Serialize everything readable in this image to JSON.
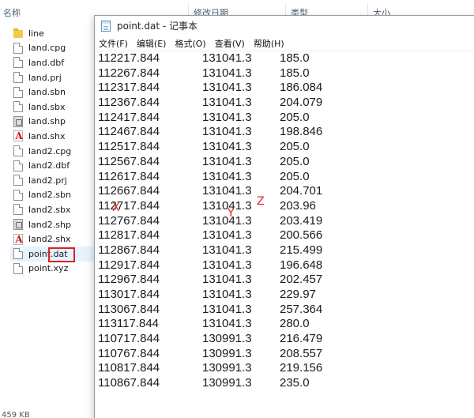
{
  "explorer": {
    "columns": [
      "名称",
      "修改日期",
      "类型",
      "大小"
    ],
    "files": [
      {
        "name": "line",
        "icon": "folder-icon"
      },
      {
        "name": "land.cpg",
        "icon": "file-icon"
      },
      {
        "name": "land.dbf",
        "icon": "file-icon"
      },
      {
        "name": "land.prj",
        "icon": "file-icon"
      },
      {
        "name": "land.sbn",
        "icon": "file-icon"
      },
      {
        "name": "land.sbx",
        "icon": "file-icon"
      },
      {
        "name": "land.shp",
        "icon": "shp-file-icon"
      },
      {
        "name": "land.shx",
        "icon": "shx-file-icon"
      },
      {
        "name": "land2.cpg",
        "icon": "file-icon"
      },
      {
        "name": "land2.dbf",
        "icon": "file-icon"
      },
      {
        "name": "land2.prj",
        "icon": "file-icon"
      },
      {
        "name": "land2.sbn",
        "icon": "file-icon"
      },
      {
        "name": "land2.sbx",
        "icon": "file-icon"
      },
      {
        "name": "land2.shp",
        "icon": "shp-file-icon"
      },
      {
        "name": "land2.shx",
        "icon": "shx-file-icon"
      },
      {
        "name": "point.dat",
        "icon": "file-icon",
        "selected": true
      },
      {
        "name": "point.xyz",
        "icon": "file-icon"
      }
    ],
    "status": "459 KB"
  },
  "notepad": {
    "title": "point.dat - 记事本",
    "menu": [
      "文件(F)",
      "编辑(E)",
      "格式(O)",
      "查看(V)",
      "帮助(H)"
    ],
    "rows": [
      [
        "112217.844",
        "131041.3",
        "185.0"
      ],
      [
        "112267.844",
        "131041.3",
        "185.0"
      ],
      [
        "112317.844",
        "131041.3",
        "186.084"
      ],
      [
        "112367.844",
        "131041.3",
        "204.079"
      ],
      [
        "112417.844",
        "131041.3",
        "205.0"
      ],
      [
        "112467.844",
        "131041.3",
        "198.846"
      ],
      [
        "112517.844",
        "131041.3",
        "205.0"
      ],
      [
        "112567.844",
        "131041.3",
        "205.0"
      ],
      [
        "112617.844",
        "131041.3",
        "205.0"
      ],
      [
        "112667.844",
        "131041.3",
        "204.701"
      ],
      [
        "112717.844",
        "131041.3",
        "203.96"
      ],
      [
        "112767.844",
        "131041.3",
        "203.419"
      ],
      [
        "112817.844",
        "131041.3",
        "200.566"
      ],
      [
        "112867.844",
        "131041.3",
        "215.499"
      ],
      [
        "112917.844",
        "131041.3",
        "196.648"
      ],
      [
        "112967.844",
        "131041.3",
        "202.457"
      ],
      [
        "113017.844",
        "131041.3",
        "229.97"
      ],
      [
        "113067.844",
        "131041.3",
        "257.364"
      ],
      [
        "113117.844",
        "131041.3",
        "280.0"
      ],
      [
        "110717.844",
        "130991.3",
        "216.479"
      ],
      [
        "110767.844",
        "130991.3",
        "208.557"
      ],
      [
        "110817.844",
        "130991.3",
        "219.156"
      ],
      [
        "110867.844",
        "130991.3",
        "235.0"
      ]
    ]
  },
  "annotations": {
    "x_label": "X",
    "y_label": "Y",
    "z_label": "Z",
    "color": "#e02020"
  }
}
